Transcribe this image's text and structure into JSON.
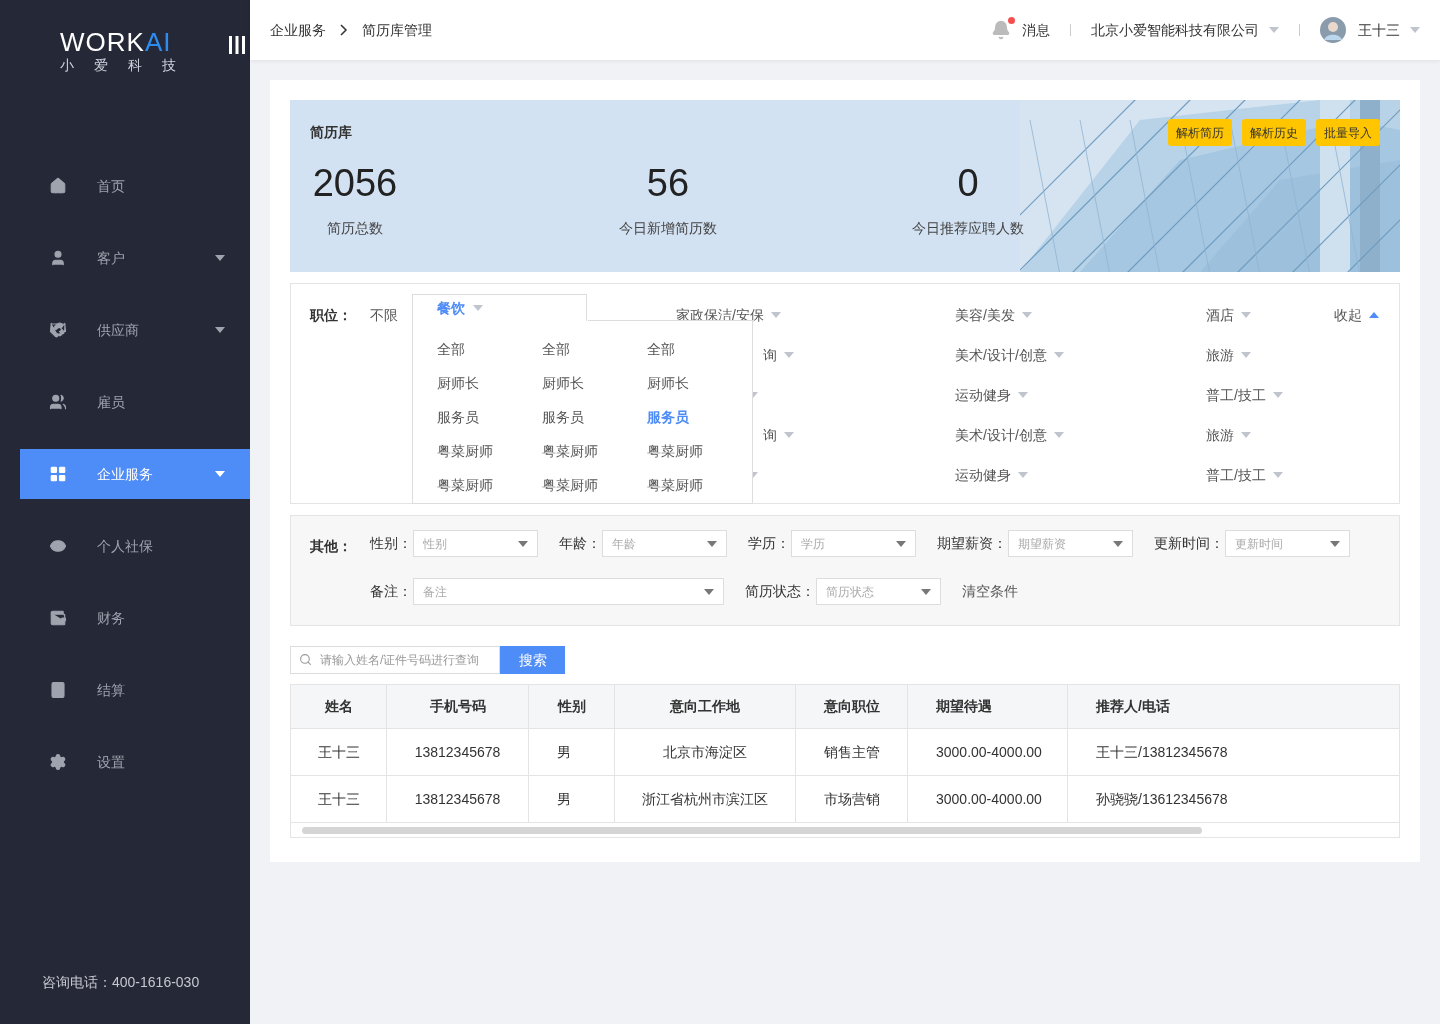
{
  "sidebar": {
    "logo": {
      "white": "WORK",
      "blue": "AI",
      "subtitle": "小爱科技"
    },
    "items": [
      {
        "label": "首页",
        "caret": false,
        "selected": false
      },
      {
        "label": "客户",
        "caret": true,
        "selected": false
      },
      {
        "label": "供应商",
        "caret": true,
        "selected": false
      },
      {
        "label": "雇员",
        "caret": false,
        "selected": false
      },
      {
        "label": "企业服务",
        "caret": true,
        "selected": true
      },
      {
        "label": "个人社保",
        "caret": false,
        "selected": false
      },
      {
        "label": "财务",
        "caret": false,
        "selected": false
      },
      {
        "label": "结算",
        "caret": false,
        "selected": false
      },
      {
        "label": "设置",
        "caret": false,
        "selected": false
      }
    ],
    "footer": "咨询电话：400-1616-030"
  },
  "header": {
    "breadcrumbs": [
      "企业服务",
      "简历库管理"
    ],
    "messages": {
      "label": "消息",
      "unread": true
    },
    "company": "北京小爱智能科技有限公司",
    "user": "王十三"
  },
  "banner": {
    "title": "简历库",
    "actions": [
      "解析简历",
      "解析历史",
      "批量导入"
    ],
    "stats": [
      {
        "value": "2056",
        "label": "简历总数"
      },
      {
        "value": "56",
        "label": "今日新增简历数"
      },
      {
        "value": "0",
        "label": "今日推荐应聘人数"
      }
    ]
  },
  "position_filter": {
    "label": "职位：",
    "any": "不限",
    "collapse": "收起",
    "dropdown": {
      "category": "餐饮",
      "columns": [
        [
          {
            "label": "全部",
            "selected": false
          },
          {
            "label": "厨师长",
            "selected": false
          },
          {
            "label": "服务员",
            "selected": false
          },
          {
            "label": "粤菜厨师",
            "selected": false
          },
          {
            "label": "粤菜厨师",
            "selected": false
          }
        ],
        [
          {
            "label": "全部",
            "selected": false
          },
          {
            "label": "厨师长",
            "selected": false
          },
          {
            "label": "服务员",
            "selected": false
          },
          {
            "label": "粤菜厨师",
            "selected": false
          },
          {
            "label": "粤菜厨师",
            "selected": false
          }
        ],
        [
          {
            "label": "全部",
            "selected": false
          },
          {
            "label": "厨师长",
            "selected": false
          },
          {
            "label": "服务员",
            "selected": true
          },
          {
            "label": "粤菜厨师",
            "selected": false
          },
          {
            "label": "粤菜厨师",
            "selected": false
          }
        ]
      ]
    },
    "rows": [
      [
        {
          "kind": "full",
          "label": "家政保洁/安保"
        },
        {
          "kind": "full",
          "label": "美容/美发"
        },
        {
          "kind": "full",
          "label": "酒店"
        }
      ],
      [
        {
          "kind": "cut",
          "label": "询"
        },
        {
          "kind": "full",
          "label": "美术/设计/创意"
        },
        {
          "kind": "full",
          "label": "旅游"
        }
      ],
      [
        {
          "kind": "covered"
        },
        {
          "kind": "full",
          "label": "运动健身"
        },
        {
          "kind": "full",
          "label": "普工/技工"
        }
      ],
      [
        {
          "kind": "cut",
          "label": "询"
        },
        {
          "kind": "full",
          "label": "美术/设计/创意"
        },
        {
          "kind": "full",
          "label": "旅游"
        }
      ],
      [
        {
          "kind": "covered"
        },
        {
          "kind": "full",
          "label": "运动健身"
        },
        {
          "kind": "full",
          "label": "普工/技工"
        }
      ]
    ]
  },
  "other_filter": {
    "label": "其他：",
    "fields": [
      {
        "label": "性别：",
        "placeholder": "性别"
      },
      {
        "label": "年龄：",
        "placeholder": "年龄"
      },
      {
        "label": "学历：",
        "placeholder": "学历"
      },
      {
        "label": "期望薪资：",
        "placeholder": "期望薪资"
      },
      {
        "label": "更新时间：",
        "placeholder": "更新时间"
      },
      {
        "label": "备注：",
        "placeholder": "备注"
      },
      {
        "label": "简历状态：",
        "placeholder": "简历状态"
      }
    ],
    "clear": "清空条件"
  },
  "search": {
    "placeholder": "请输入姓名/证件号码进行查询",
    "button": "搜索"
  },
  "table": {
    "columns": [
      "姓名",
      "手机号码",
      "性别",
      "意向工作地",
      "意向职位",
      "期望待遇",
      "推荐人/电话"
    ],
    "rows": [
      [
        "王十三",
        "13812345678",
        "男",
        "北京市海淀区",
        "销售主管",
        "3000.00-4000.00",
        "王十三/13812345678"
      ],
      [
        "王十三",
        "13812345678",
        "男",
        "浙江省杭州市滨江区",
        "市场营销",
        "3000.00-4000.00",
        "孙骁骁/13612345678"
      ]
    ]
  }
}
